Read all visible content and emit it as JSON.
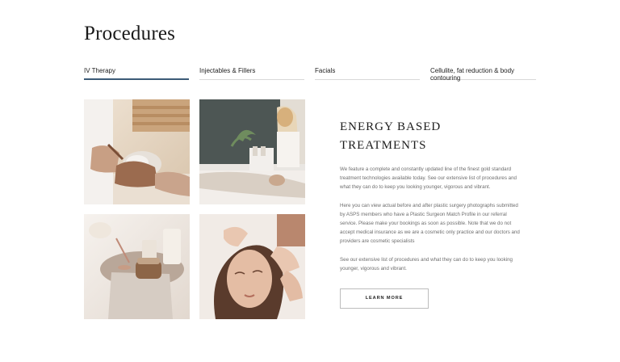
{
  "page": {
    "title": "Procedures"
  },
  "tabs": [
    {
      "label": "IV Therapy",
      "active": true
    },
    {
      "label": "Injectables & Fillers",
      "active": false
    },
    {
      "label": "Facials",
      "active": false
    },
    {
      "label": "Cellulite, fat reduction & body contouring",
      "active": false
    }
  ],
  "section": {
    "heading_line1": "Energy Based",
    "heading_line2": "Treatments",
    "paragraphs": [
      "We feature a complete and constantly updated line of the finest gold standard treatment technologies available today. See our extensive list of procedures and what they can do to keep you looking younger, vigorous and vibrant.",
      "Here you can view actual before and after plastic surgery photographs submitted by ASPS members who have a Plastic Surgeon Match Profile in our referral service. Please make your bookings as soon as possible. Note that we do not accept medical insurance as we are a cosmetic only practice and our doctors and providers are cosmetic specialists",
      "See our extensive list of procedures and what they can do to keep you looking younger, vigorous and vibrant."
    ],
    "button_label": "Learn More"
  },
  "images": [
    {
      "name": "facial-mask-photo"
    },
    {
      "name": "massage-room-photo"
    },
    {
      "name": "candles-spa-photo"
    },
    {
      "name": "face-massage-photo"
    }
  ],
  "colors": {
    "active_tab_underline": "#3c5b77",
    "body_text": "#6e6e6e",
    "heading": "#1c1c1c"
  }
}
